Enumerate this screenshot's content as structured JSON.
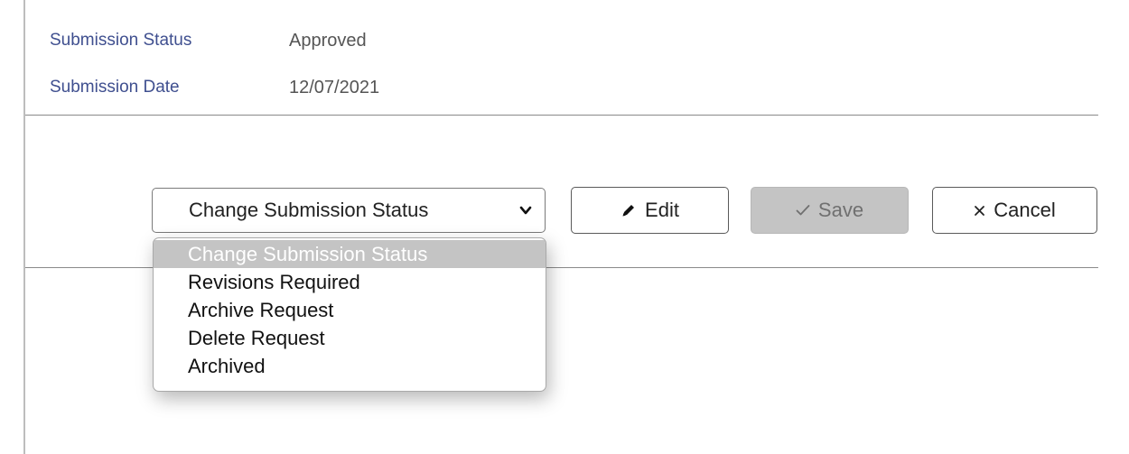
{
  "submission": {
    "status_label": "Submission Status",
    "status_value": "Approved",
    "date_label": "Submission Date",
    "date_value": "12/07/2021"
  },
  "status_select": {
    "selected": "Change Submission Status",
    "options": [
      {
        "label": "Change Submission Status",
        "highlighted": true
      },
      {
        "label": "Revisions Required",
        "highlighted": false
      },
      {
        "label": "Archive Request",
        "highlighted": false
      },
      {
        "label": "Delete Request",
        "highlighted": false
      },
      {
        "label": "Archived",
        "highlighted": false
      }
    ]
  },
  "buttons": {
    "edit": {
      "label": "Edit",
      "icon": "pencil-icon"
    },
    "save": {
      "label": "Save",
      "icon": "checkmark-icon",
      "disabled": true
    },
    "cancel": {
      "label": "Cancel",
      "icon": "close-icon"
    }
  },
  "colors": {
    "label": "#3f4f8f",
    "disabled_button": "#c4c4c4",
    "option_highlight": "#c4c4c4"
  }
}
